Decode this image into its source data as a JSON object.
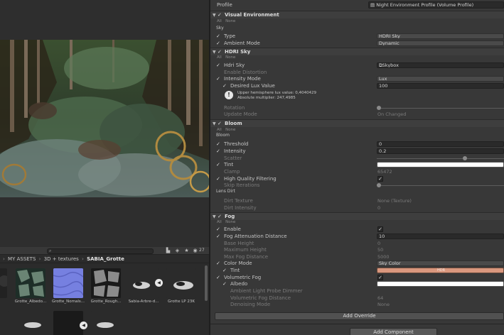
{
  "profile": {
    "label": "Profile",
    "value": "Night Environment Profile (Volume Profile)"
  },
  "common": {
    "all": "All",
    "none": "None"
  },
  "visual_env": {
    "title": "Visual Environment",
    "sky_label": "Sky",
    "type_label": "Type",
    "type_value": "HDRI Sky",
    "ambient_label": "Ambient Mode",
    "ambient_value": "Dynamic"
  },
  "hdri": {
    "title": "HDRI Sky",
    "hdri_label": "Hdri Sky",
    "hdri_value": "Skybox",
    "distortion_label": "Enable Distortion",
    "intensity_mode_label": "Intensity Mode",
    "intensity_mode_value": "Lux",
    "lux_label": "Desired Lux Value",
    "lux_value": "100",
    "warn_line1": "Upper hemisphere lux value: 0,4040429",
    "warn_line2": "Absolute multiplier: 247,4985",
    "rotation_label": "Rotation",
    "rotation_level": 0.0,
    "update_label": "Update Mode",
    "update_value": "On Changed"
  },
  "bloom": {
    "title": "Bloom",
    "sub": "Bloom",
    "threshold_label": "Threshold",
    "threshold_value": "0",
    "intensity_label": "Intensity",
    "intensity_value": "0.2",
    "scatter_label": "Scatter",
    "scatter_level": 0.7,
    "tint_label": "Tint",
    "clamp_label": "Clamp",
    "clamp_value": "65472",
    "hq_label": "High Quality Filtering",
    "skip_label": "Skip Iterations",
    "skip_level": 0.0,
    "lens_dirt": "Lens Dirt",
    "dirt_tex_label": "Dirt Texture",
    "dirt_tex_value": "None (Texture)",
    "dirt_int_label": "Dirt Intensity",
    "dirt_int_value": "0"
  },
  "fog": {
    "title": "Fog",
    "enable_label": "Enable",
    "atten_label": "Fog Attenuation Distance",
    "atten_value": "10",
    "base_label": "Base Height",
    "base_value": "0",
    "max_label": "Maximum Height",
    "max_value": "50",
    "maxdist_label": "Max Fog Distance",
    "maxdist_value": "5000",
    "color_mode_label": "Color Mode",
    "color_mode_value": "Sky Color",
    "tint_label": "Tint",
    "tint_value": "HDR",
    "vol_label": "Volumetric Fog",
    "albedo_label": "Albedo",
    "ambient_probe_label": "Ambient Light Probe Dimmer",
    "vol_dist_label": "Volumetric Fog Distance",
    "vol_dist_value": "64",
    "denoise_label": "Denoising Mode",
    "denoise_value": "None"
  },
  "buttons": {
    "add_override": "Add Override",
    "add_component": "Add Component"
  },
  "project": {
    "count": "27",
    "breadcrumb": [
      "MY ASSETS",
      "3D + textures",
      "SABIA_Grotte"
    ],
    "assets": [
      "Grotte_Albedo...",
      "Grotte_Nomals...",
      "Grotte_Rough...",
      "Sabia-Arbre-d...",
      "Grotte LP 23K"
    ]
  },
  "colors": {
    "accent_fog_tint": "#d9977e",
    "bloom_tint": "#ffffff"
  }
}
